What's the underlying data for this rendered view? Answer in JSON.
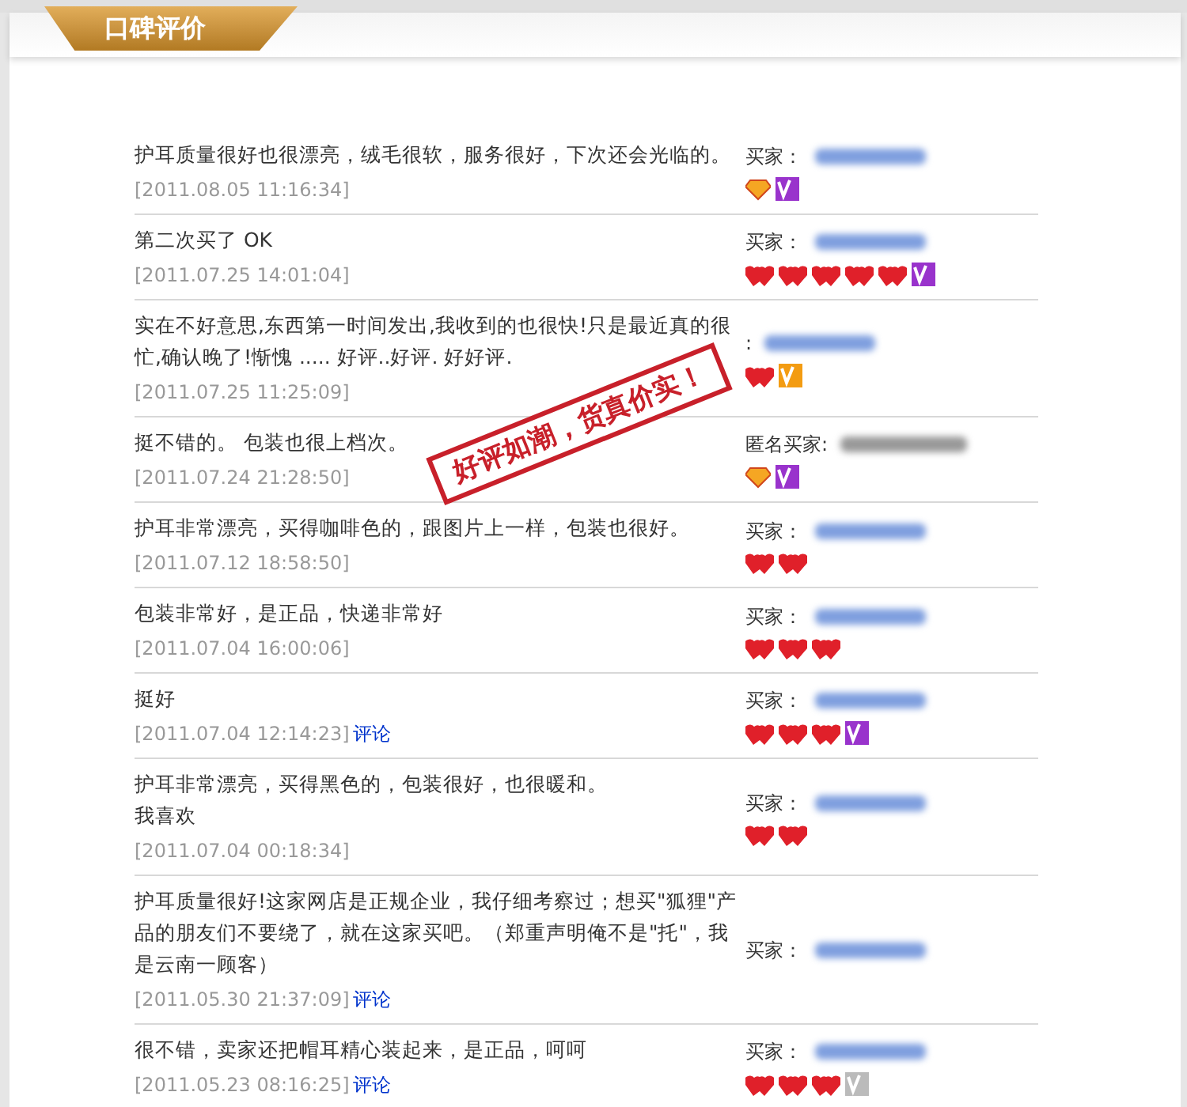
{
  "section_title": "口碑评价",
  "stamp": [
    "好评如潮，",
    "货真价实！"
  ],
  "reviews": [
    {
      "text": "护耳质量很好也很漂亮，绒毛很软，服务很好，下次还会光临的。",
      "date": "[2011.08.05 11:16:34]",
      "buyer": {
        "label": "买家：",
        "kind": "member"
      },
      "badges": [
        {
          "kind": "diamond"
        },
        {
          "kind": "vip",
          "color": "#9933cc"
        }
      ]
    },
    {
      "text": "第二次买了 OK",
      "date": "[2011.07.25 14:01:04]",
      "buyer": {
        "label": "买家：",
        "kind": "member"
      },
      "badges": [
        {
          "kind": "heart"
        },
        {
          "kind": "heart"
        },
        {
          "kind": "heart"
        },
        {
          "kind": "heart"
        },
        {
          "kind": "heart"
        },
        {
          "kind": "vip",
          "color": "#9933cc"
        }
      ]
    },
    {
      "text": "实在不好意思,东西第一时间发出,我收到的也很快!只是最近真的很",
      "text_continued": "忙,确认晚了!惭愧 ..... 好评..好评. 好好评.",
      "date": "[2011.07.25 11:25:09]",
      "buyer": {
        "label": ":",
        "kind": "member"
      },
      "badges": [
        {
          "kind": "heart"
        },
        {
          "kind": "vip",
          "color": "#f39c12"
        }
      ]
    },
    {
      "text": "挺不错的。 包装也很上档次。",
      "date": "[2011.07.24 21:28:50]",
      "buyer": {
        "label": "匿名买家:",
        "kind": "anonymous"
      },
      "badges": [
        {
          "kind": "diamond"
        },
        {
          "kind": "vip",
          "color": "#9933cc"
        }
      ]
    },
    {
      "text": "护耳非常漂亮，买得咖啡色的，跟图片上一样，包装也很好。",
      "date": "[2011.07.12 18:58:50]",
      "buyer": {
        "label": "买家：",
        "kind": "member"
      },
      "badges": [
        {
          "kind": "heart"
        },
        {
          "kind": "heart"
        }
      ]
    },
    {
      "text": "包装非常好，是正品，快递非常好",
      "date": "[2011.07.04 16:00:06]",
      "buyer": {
        "label": "买家：",
        "kind": "member"
      },
      "badges": [
        {
          "kind": "heart"
        },
        {
          "kind": "heart"
        },
        {
          "kind": "heart"
        }
      ]
    },
    {
      "text": "挺好",
      "date": "[2011.07.04 12:14:23]",
      "link": "评论",
      "buyer": {
        "label": "买家：",
        "kind": "member"
      },
      "badges": [
        {
          "kind": "heart"
        },
        {
          "kind": "heart"
        },
        {
          "kind": "heart"
        },
        {
          "kind": "vip",
          "color": "#9933cc"
        }
      ]
    },
    {
      "text": "护耳非常漂亮，买得黑色的，包装很好，也很暖和。",
      "text_continued": "我喜欢",
      "date": "[2011.07.04 00:18:34]",
      "buyer": {
        "label": "买家：",
        "kind": "member"
      },
      "badges": [
        {
          "kind": "heart"
        },
        {
          "kind": "heart"
        }
      ]
    },
    {
      "text": "护耳质量很好!这家网店是正规企业，我仔细考察过；想买\"狐狸\"产品的朋友们不要绕了，就在这家买吧。（郑重声明俺不是\"托\"，我是云南一顾客）",
      "date": "[2011.05.30 21:37:09]",
      "link": "评论",
      "buyer": {
        "label": "买家：",
        "kind": "member"
      }
    },
    {
      "text": "很不错，卖家还把帽耳精心装起来，是正品，呵呵",
      "date": "[2011.05.23 08:16:25]",
      "link": "评论",
      "buyer": {
        "label": "买家：",
        "kind": "member"
      },
      "badges": [
        {
          "kind": "heart"
        },
        {
          "kind": "heart"
        },
        {
          "kind": "heart"
        },
        {
          "kind": "vip",
          "color": "#bbbbbb"
        }
      ]
    }
  ]
}
